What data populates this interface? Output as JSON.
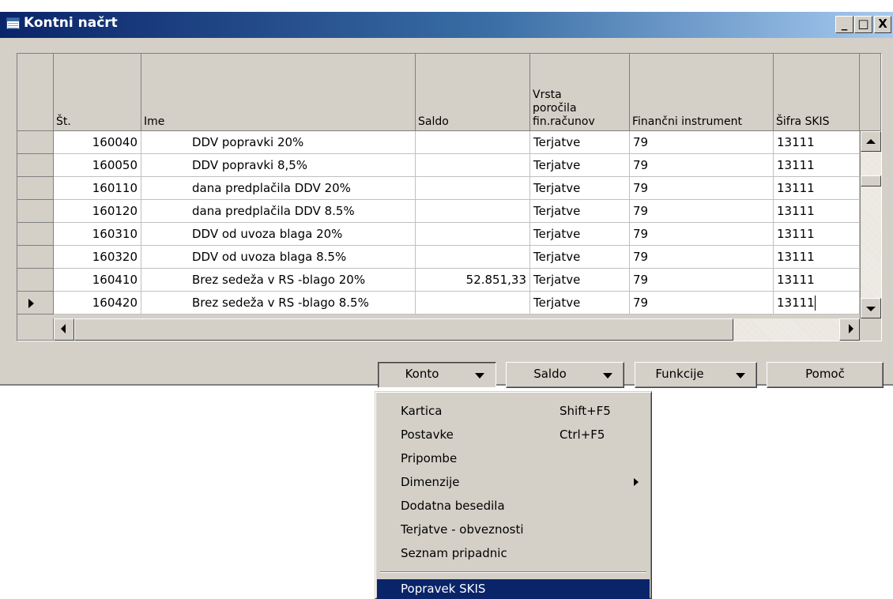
{
  "window": {
    "title": "Kontni načrt",
    "controls": {
      "minimize": "_",
      "maximize": "□",
      "close": "X"
    }
  },
  "table": {
    "columns": {
      "st": "Št.",
      "ime": "Ime",
      "saldo": "Saldo",
      "vrsta": "Vrsta\nporočila\nfin.računov",
      "fin": "Finančni instrument",
      "skis": "Šifra SKIS"
    },
    "rows": [
      {
        "st": "160040",
        "ime": "DDV popravki 20%",
        "saldo": "",
        "vrsta": "Terjatve",
        "fin": "79",
        "skis": "13111"
      },
      {
        "st": "160050",
        "ime": "DDV popravki 8,5%",
        "saldo": "",
        "vrsta": "Terjatve",
        "fin": "79",
        "skis": "13111"
      },
      {
        "st": "160110",
        "ime": "dana predplačila DDV 20%",
        "saldo": "",
        "vrsta": "Terjatve",
        "fin": "79",
        "skis": "13111"
      },
      {
        "st": "160120",
        "ime": "dana predplačila DDV 8.5%",
        "saldo": "",
        "vrsta": "Terjatve",
        "fin": "79",
        "skis": "13111"
      },
      {
        "st": "160310",
        "ime": "DDV od uvoza blaga 20%",
        "saldo": "",
        "vrsta": "Terjatve",
        "fin": "79",
        "skis": "13111"
      },
      {
        "st": "160320",
        "ime": "DDV od uvoza blaga 8.5%",
        "saldo": "",
        "vrsta": "Terjatve",
        "fin": "79",
        "skis": "13111"
      },
      {
        "st": "160410",
        "ime": "Brez sedeža v RS -blago 20%",
        "saldo": "52.851,33",
        "vrsta": "Terjatve",
        "fin": "79",
        "skis": "13111"
      },
      {
        "st": "160420",
        "ime": "Brez sedeža v RS -blago 8.5%",
        "saldo": "",
        "vrsta": "Terjatve",
        "fin": "79",
        "skis": "13111"
      }
    ],
    "current_row_index": 7
  },
  "buttons": {
    "konto": "Konto",
    "saldo": "Saldo",
    "funkcije": "Funkcije",
    "pomoc": "Pomoč"
  },
  "menu": {
    "items": [
      {
        "label": "Kartica",
        "shortcut": "Shift+F5"
      },
      {
        "label": "Postavke",
        "shortcut": "Ctrl+F5"
      },
      {
        "label": "Pripombe",
        "shortcut": ""
      },
      {
        "label": "Dimenzije",
        "shortcut": ""
      },
      {
        "label": "Dodatna besedila",
        "shortcut": ""
      },
      {
        "label": "Terjatve - obveznosti",
        "shortcut": ""
      },
      {
        "label": "Seznam pripadnic",
        "shortcut": ""
      },
      {
        "label": "Popravek SKIS",
        "shortcut": ""
      }
    ],
    "highlighted": "Popravek SKIS"
  },
  "colors": {
    "title_bar": "#0a246a",
    "window_face": "#d4d0c8",
    "menu_highlight": "#0a246a"
  }
}
